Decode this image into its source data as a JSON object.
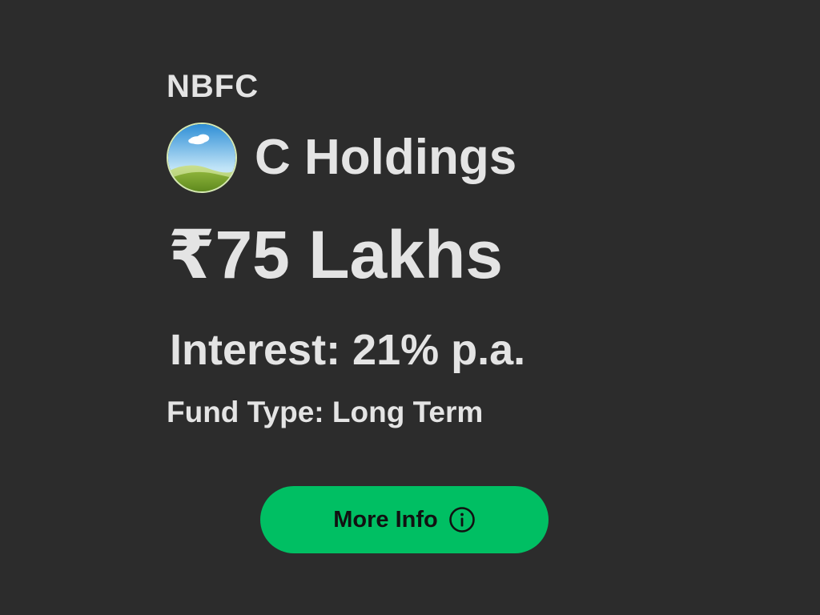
{
  "category": "NBFC",
  "company": {
    "name": "C Holdings",
    "avatar_icon": "landscape-placeholder-icon"
  },
  "amount": "₹75 Lakhs",
  "interest": "Interest: 21% p.a.",
  "fund_type": "Fund Type: Long Term",
  "button": {
    "label": "More Info",
    "icon": "info-circle-icon"
  },
  "colors": {
    "background": "#2c2c2c",
    "text": "#e4e4e4",
    "button": "#00bf63",
    "button_text": "#111111"
  }
}
